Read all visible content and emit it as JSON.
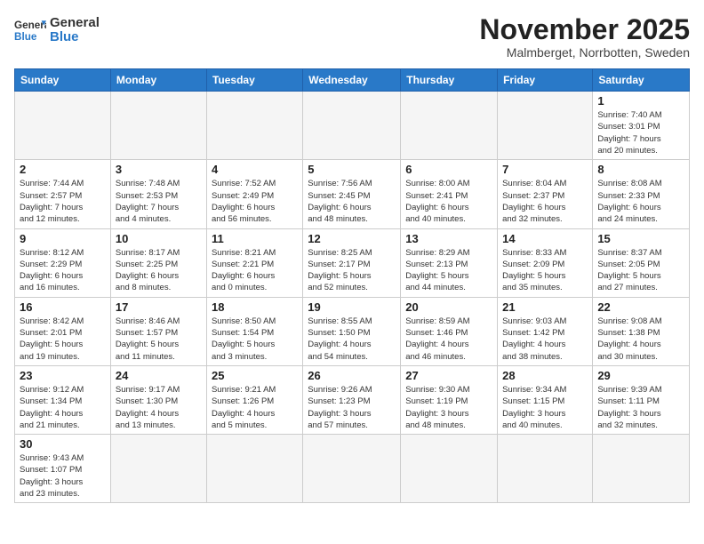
{
  "logo": {
    "text_general": "General",
    "text_blue": "Blue"
  },
  "header": {
    "month": "November 2025",
    "location": "Malmberget, Norrbotten, Sweden"
  },
  "weekdays": [
    "Sunday",
    "Monday",
    "Tuesday",
    "Wednesday",
    "Thursday",
    "Friday",
    "Saturday"
  ],
  "weeks": [
    [
      {
        "day": "",
        "info": ""
      },
      {
        "day": "",
        "info": ""
      },
      {
        "day": "",
        "info": ""
      },
      {
        "day": "",
        "info": ""
      },
      {
        "day": "",
        "info": ""
      },
      {
        "day": "",
        "info": ""
      },
      {
        "day": "1",
        "info": "Sunrise: 7:40 AM\nSunset: 3:01 PM\nDaylight: 7 hours\nand 20 minutes."
      }
    ],
    [
      {
        "day": "2",
        "info": "Sunrise: 7:44 AM\nSunset: 2:57 PM\nDaylight: 7 hours\nand 12 minutes."
      },
      {
        "day": "3",
        "info": "Sunrise: 7:48 AM\nSunset: 2:53 PM\nDaylight: 7 hours\nand 4 minutes."
      },
      {
        "day": "4",
        "info": "Sunrise: 7:52 AM\nSunset: 2:49 PM\nDaylight: 6 hours\nand 56 minutes."
      },
      {
        "day": "5",
        "info": "Sunrise: 7:56 AM\nSunset: 2:45 PM\nDaylight: 6 hours\nand 48 minutes."
      },
      {
        "day": "6",
        "info": "Sunrise: 8:00 AM\nSunset: 2:41 PM\nDaylight: 6 hours\nand 40 minutes."
      },
      {
        "day": "7",
        "info": "Sunrise: 8:04 AM\nSunset: 2:37 PM\nDaylight: 6 hours\nand 32 minutes."
      },
      {
        "day": "8",
        "info": "Sunrise: 8:08 AM\nSunset: 2:33 PM\nDaylight: 6 hours\nand 24 minutes."
      }
    ],
    [
      {
        "day": "9",
        "info": "Sunrise: 8:12 AM\nSunset: 2:29 PM\nDaylight: 6 hours\nand 16 minutes."
      },
      {
        "day": "10",
        "info": "Sunrise: 8:17 AM\nSunset: 2:25 PM\nDaylight: 6 hours\nand 8 minutes."
      },
      {
        "day": "11",
        "info": "Sunrise: 8:21 AM\nSunset: 2:21 PM\nDaylight: 6 hours\nand 0 minutes."
      },
      {
        "day": "12",
        "info": "Sunrise: 8:25 AM\nSunset: 2:17 PM\nDaylight: 5 hours\nand 52 minutes."
      },
      {
        "day": "13",
        "info": "Sunrise: 8:29 AM\nSunset: 2:13 PM\nDaylight: 5 hours\nand 44 minutes."
      },
      {
        "day": "14",
        "info": "Sunrise: 8:33 AM\nSunset: 2:09 PM\nDaylight: 5 hours\nand 35 minutes."
      },
      {
        "day": "15",
        "info": "Sunrise: 8:37 AM\nSunset: 2:05 PM\nDaylight: 5 hours\nand 27 minutes."
      }
    ],
    [
      {
        "day": "16",
        "info": "Sunrise: 8:42 AM\nSunset: 2:01 PM\nDaylight: 5 hours\nand 19 minutes."
      },
      {
        "day": "17",
        "info": "Sunrise: 8:46 AM\nSunset: 1:57 PM\nDaylight: 5 hours\nand 11 minutes."
      },
      {
        "day": "18",
        "info": "Sunrise: 8:50 AM\nSunset: 1:54 PM\nDaylight: 5 hours\nand 3 minutes."
      },
      {
        "day": "19",
        "info": "Sunrise: 8:55 AM\nSunset: 1:50 PM\nDaylight: 4 hours\nand 54 minutes."
      },
      {
        "day": "20",
        "info": "Sunrise: 8:59 AM\nSunset: 1:46 PM\nDaylight: 4 hours\nand 46 minutes."
      },
      {
        "day": "21",
        "info": "Sunrise: 9:03 AM\nSunset: 1:42 PM\nDaylight: 4 hours\nand 38 minutes."
      },
      {
        "day": "22",
        "info": "Sunrise: 9:08 AM\nSunset: 1:38 PM\nDaylight: 4 hours\nand 30 minutes."
      }
    ],
    [
      {
        "day": "23",
        "info": "Sunrise: 9:12 AM\nSunset: 1:34 PM\nDaylight: 4 hours\nand 21 minutes."
      },
      {
        "day": "24",
        "info": "Sunrise: 9:17 AM\nSunset: 1:30 PM\nDaylight: 4 hours\nand 13 minutes."
      },
      {
        "day": "25",
        "info": "Sunrise: 9:21 AM\nSunset: 1:26 PM\nDaylight: 4 hours\nand 5 minutes."
      },
      {
        "day": "26",
        "info": "Sunrise: 9:26 AM\nSunset: 1:23 PM\nDaylight: 3 hours\nand 57 minutes."
      },
      {
        "day": "27",
        "info": "Sunrise: 9:30 AM\nSunset: 1:19 PM\nDaylight: 3 hours\nand 48 minutes."
      },
      {
        "day": "28",
        "info": "Sunrise: 9:34 AM\nSunset: 1:15 PM\nDaylight: 3 hours\nand 40 minutes."
      },
      {
        "day": "29",
        "info": "Sunrise: 9:39 AM\nSunset: 1:11 PM\nDaylight: 3 hours\nand 32 minutes."
      }
    ],
    [
      {
        "day": "30",
        "info": "Sunrise: 9:43 AM\nSunset: 1:07 PM\nDaylight: 3 hours\nand 23 minutes."
      },
      {
        "day": "",
        "info": ""
      },
      {
        "day": "",
        "info": ""
      },
      {
        "day": "",
        "info": ""
      },
      {
        "day": "",
        "info": ""
      },
      {
        "day": "",
        "info": ""
      },
      {
        "day": "",
        "info": ""
      }
    ]
  ]
}
